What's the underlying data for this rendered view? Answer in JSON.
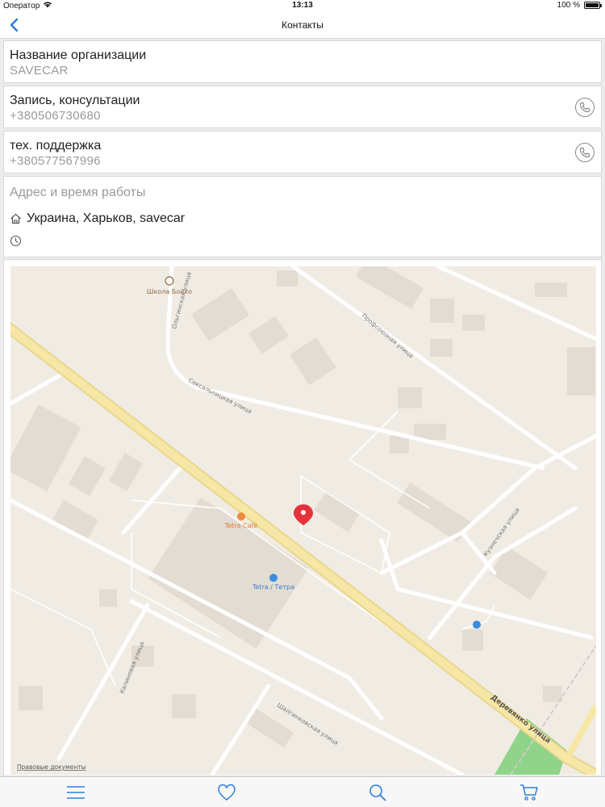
{
  "status_bar": {
    "carrier": "Оператор",
    "time": "13:13",
    "battery": "100 %",
    "battery_level": 1.0
  },
  "nav": {
    "title": "Контакты",
    "back_icon": "chevron-left-icon"
  },
  "organization": {
    "label": "Название организации",
    "value": "SAVECAR"
  },
  "contacts": [
    {
      "label": "Запись, консультации",
      "phone": "+380506730680",
      "icon": "phone-icon"
    },
    {
      "label": "тех. поддержка",
      "phone": "+380577567996",
      "icon": "phone-icon"
    }
  ],
  "address": {
    "heading": "Адрес и время работы",
    "text": "Украина, Харьков, savecar",
    "home_icon": "home-icon",
    "clock_icon": "clock-icon"
  },
  "map": {
    "pois": {
      "school": "Школа Бойко",
      "cafe": "Tetra Café",
      "shop": "Tetra / Тетра"
    },
    "streets": {
      "s1": "Ольгинская улица",
      "s2": "Профсоюзная улица",
      "s3": "Сексальницкая улица",
      "s4": "Кузнечская улица",
      "s5": "Деревянко улица",
      "s6": "Калиновая улица",
      "s7": "Шалгинковская улица"
    },
    "legal": "Правовые документы",
    "pin_icon": "map-pin-icon"
  },
  "tabs": [
    {
      "name": "menu",
      "icon": "menu-icon"
    },
    {
      "name": "favorites",
      "icon": "heart-icon"
    },
    {
      "name": "search",
      "icon": "search-icon"
    },
    {
      "name": "cart",
      "icon": "cart-icon"
    }
  ],
  "colors": {
    "accent": "#2f7fd9",
    "pin": "#e5323b",
    "road_major": "#f7e7a6",
    "map_bg": "#f1ece3",
    "building": "#e2dcd2",
    "park": "#8fd48a"
  }
}
